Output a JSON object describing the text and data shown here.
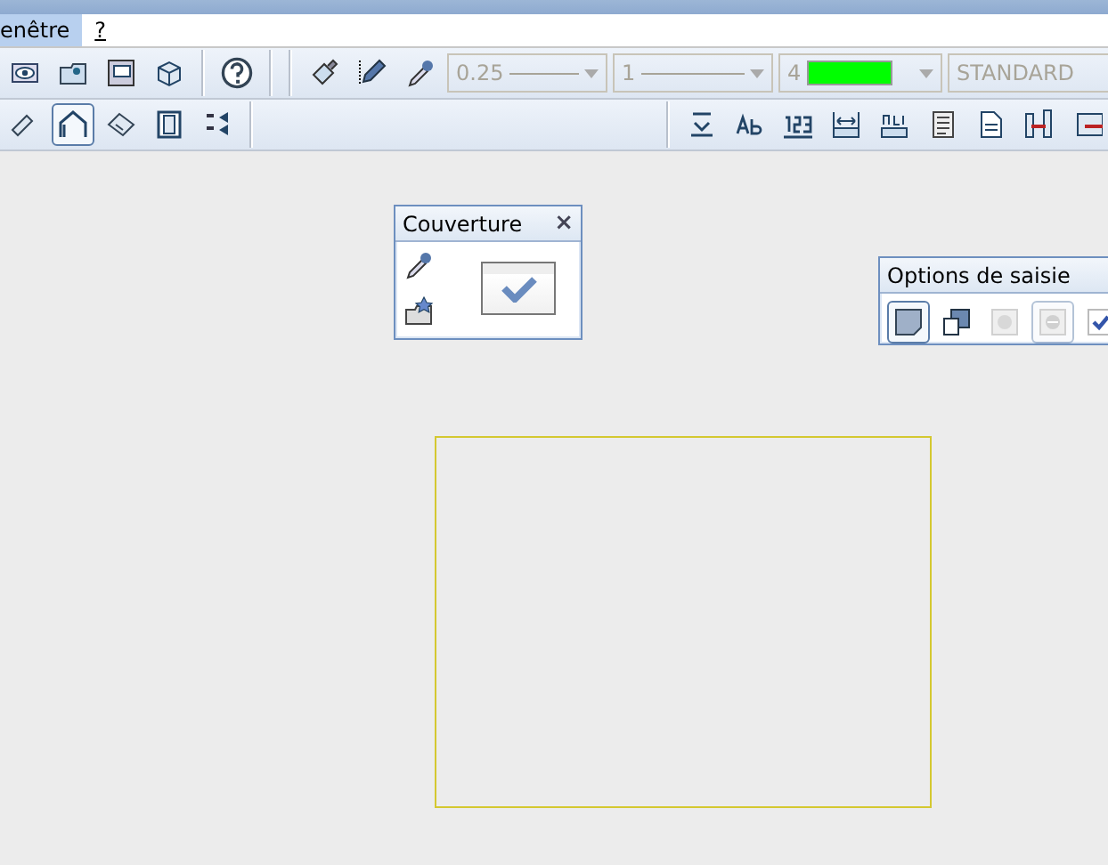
{
  "menu_bar": {
    "items": [
      {
        "label": "enêtre",
        "selected": true
      },
      {
        "label": "?",
        "selected": false
      }
    ]
  },
  "format_bar": {
    "combos": [
      {
        "value": "0.25",
        "disabled": true
      },
      {
        "value": "1",
        "disabled": true
      },
      {
        "value": "4",
        "color": "#00ff00",
        "disabled": true
      },
      {
        "value": "STANDARD",
        "disabled": true
      }
    ]
  },
  "tool_bar": {
    "left_tools": [
      {
        "selected": false
      },
      {
        "selected": true
      },
      {
        "selected": false
      },
      {
        "selected": false
      },
      {
        "selected": false
      }
    ]
  },
  "palettes": [
    {
      "title": "Couverture",
      "close": "×"
    },
    {
      "title": "Options de saisie",
      "tools": [
        {
          "selected": true,
          "disabled": false
        },
        {
          "selected": false,
          "disabled": false
        },
        {
          "selected": false,
          "disabled": true
        },
        {
          "selected": true,
          "disabled": true
        },
        {
          "selected": false,
          "disabled": false
        }
      ]
    }
  ]
}
